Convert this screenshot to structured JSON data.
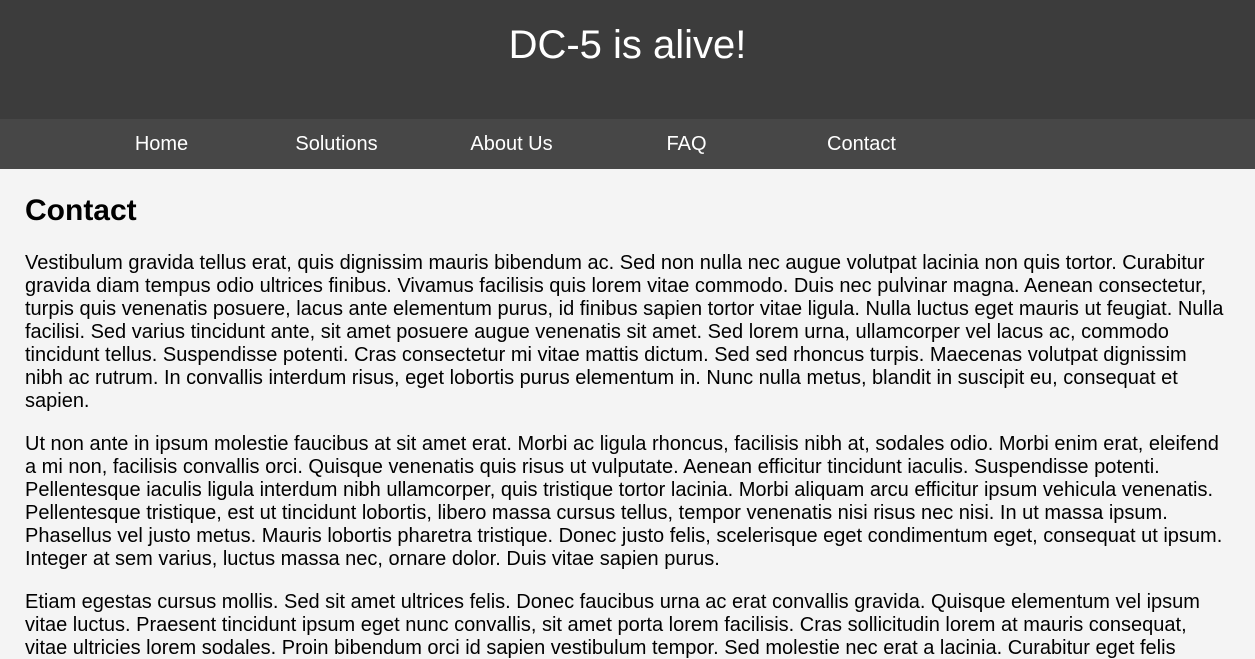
{
  "header": {
    "title": "DC-5 is alive!"
  },
  "nav": {
    "items": [
      {
        "label": "Home"
      },
      {
        "label": "Solutions"
      },
      {
        "label": "About Us"
      },
      {
        "label": "FAQ"
      },
      {
        "label": "Contact"
      }
    ]
  },
  "main": {
    "heading": "Contact",
    "paragraphs": [
      "Vestibulum gravida tellus erat, quis dignissim mauris bibendum ac. Sed non nulla nec augue volutpat lacinia non quis tortor. Curabitur gravida diam tempus odio ultrices finibus. Vivamus facilisis quis lorem vitae commodo. Duis nec pulvinar magna. Aenean consectetur, turpis quis venenatis posuere, lacus ante elementum purus, id finibus sapien tortor vitae ligula. Nulla luctus eget mauris ut feugiat. Nulla facilisi. Sed varius tincidunt ante, sit amet posuere augue venenatis sit amet. Sed lorem urna, ullamcorper vel lacus ac, commodo tincidunt tellus. Suspendisse potenti. Cras consectetur mi vitae mattis dictum. Sed sed rhoncus turpis. Maecenas volutpat dignissim nibh ac rutrum. In convallis interdum risus, eget lobortis purus elementum in. Nunc nulla metus, blandit in suscipit eu, consequat et sapien.",
      "Ut non ante in ipsum molestie faucibus at sit amet erat. Morbi ac ligula rhoncus, facilisis nibh at, sodales odio. Morbi enim erat, eleifend a mi non, facilisis convallis orci. Quisque venenatis quis risus ut vulputate. Aenean efficitur tincidunt iaculis. Suspendisse potenti. Pellentesque iaculis ligula interdum nibh ullamcorper, quis tristique tortor lacinia. Morbi aliquam arcu efficitur ipsum vehicula venenatis. Pellentesque tristique, est ut tincidunt lobortis, libero massa cursus tellus, tempor venenatis nisi risus nec nisi. In ut massa ipsum. Phasellus vel justo metus. Mauris lobortis pharetra tristique. Donec justo felis, scelerisque eget condimentum eget, consequat ut ipsum. Integer at sem varius, luctus massa nec, ornare dolor. Duis vitae sapien purus.",
      "Etiam egestas cursus mollis. Sed sit amet ultrices felis. Donec faucibus urna ac erat convallis gravida. Quisque elementum vel ipsum vitae luctus. Praesent tincidunt ipsum eget nunc convallis, sit amet porta lorem facilisis. Cras sollicitudin lorem at mauris consequat, vitae ultricies lorem sodales. Proin bibendum orci id sapien vestibulum tempor. Sed molestie nec erat a lacinia. Curabitur eget felis"
    ]
  },
  "colors": {
    "header_bg": "#3c3c3c",
    "nav_bg": "#474747",
    "page_bg": "#f4f4f4",
    "header_text": "#ffffff"
  }
}
